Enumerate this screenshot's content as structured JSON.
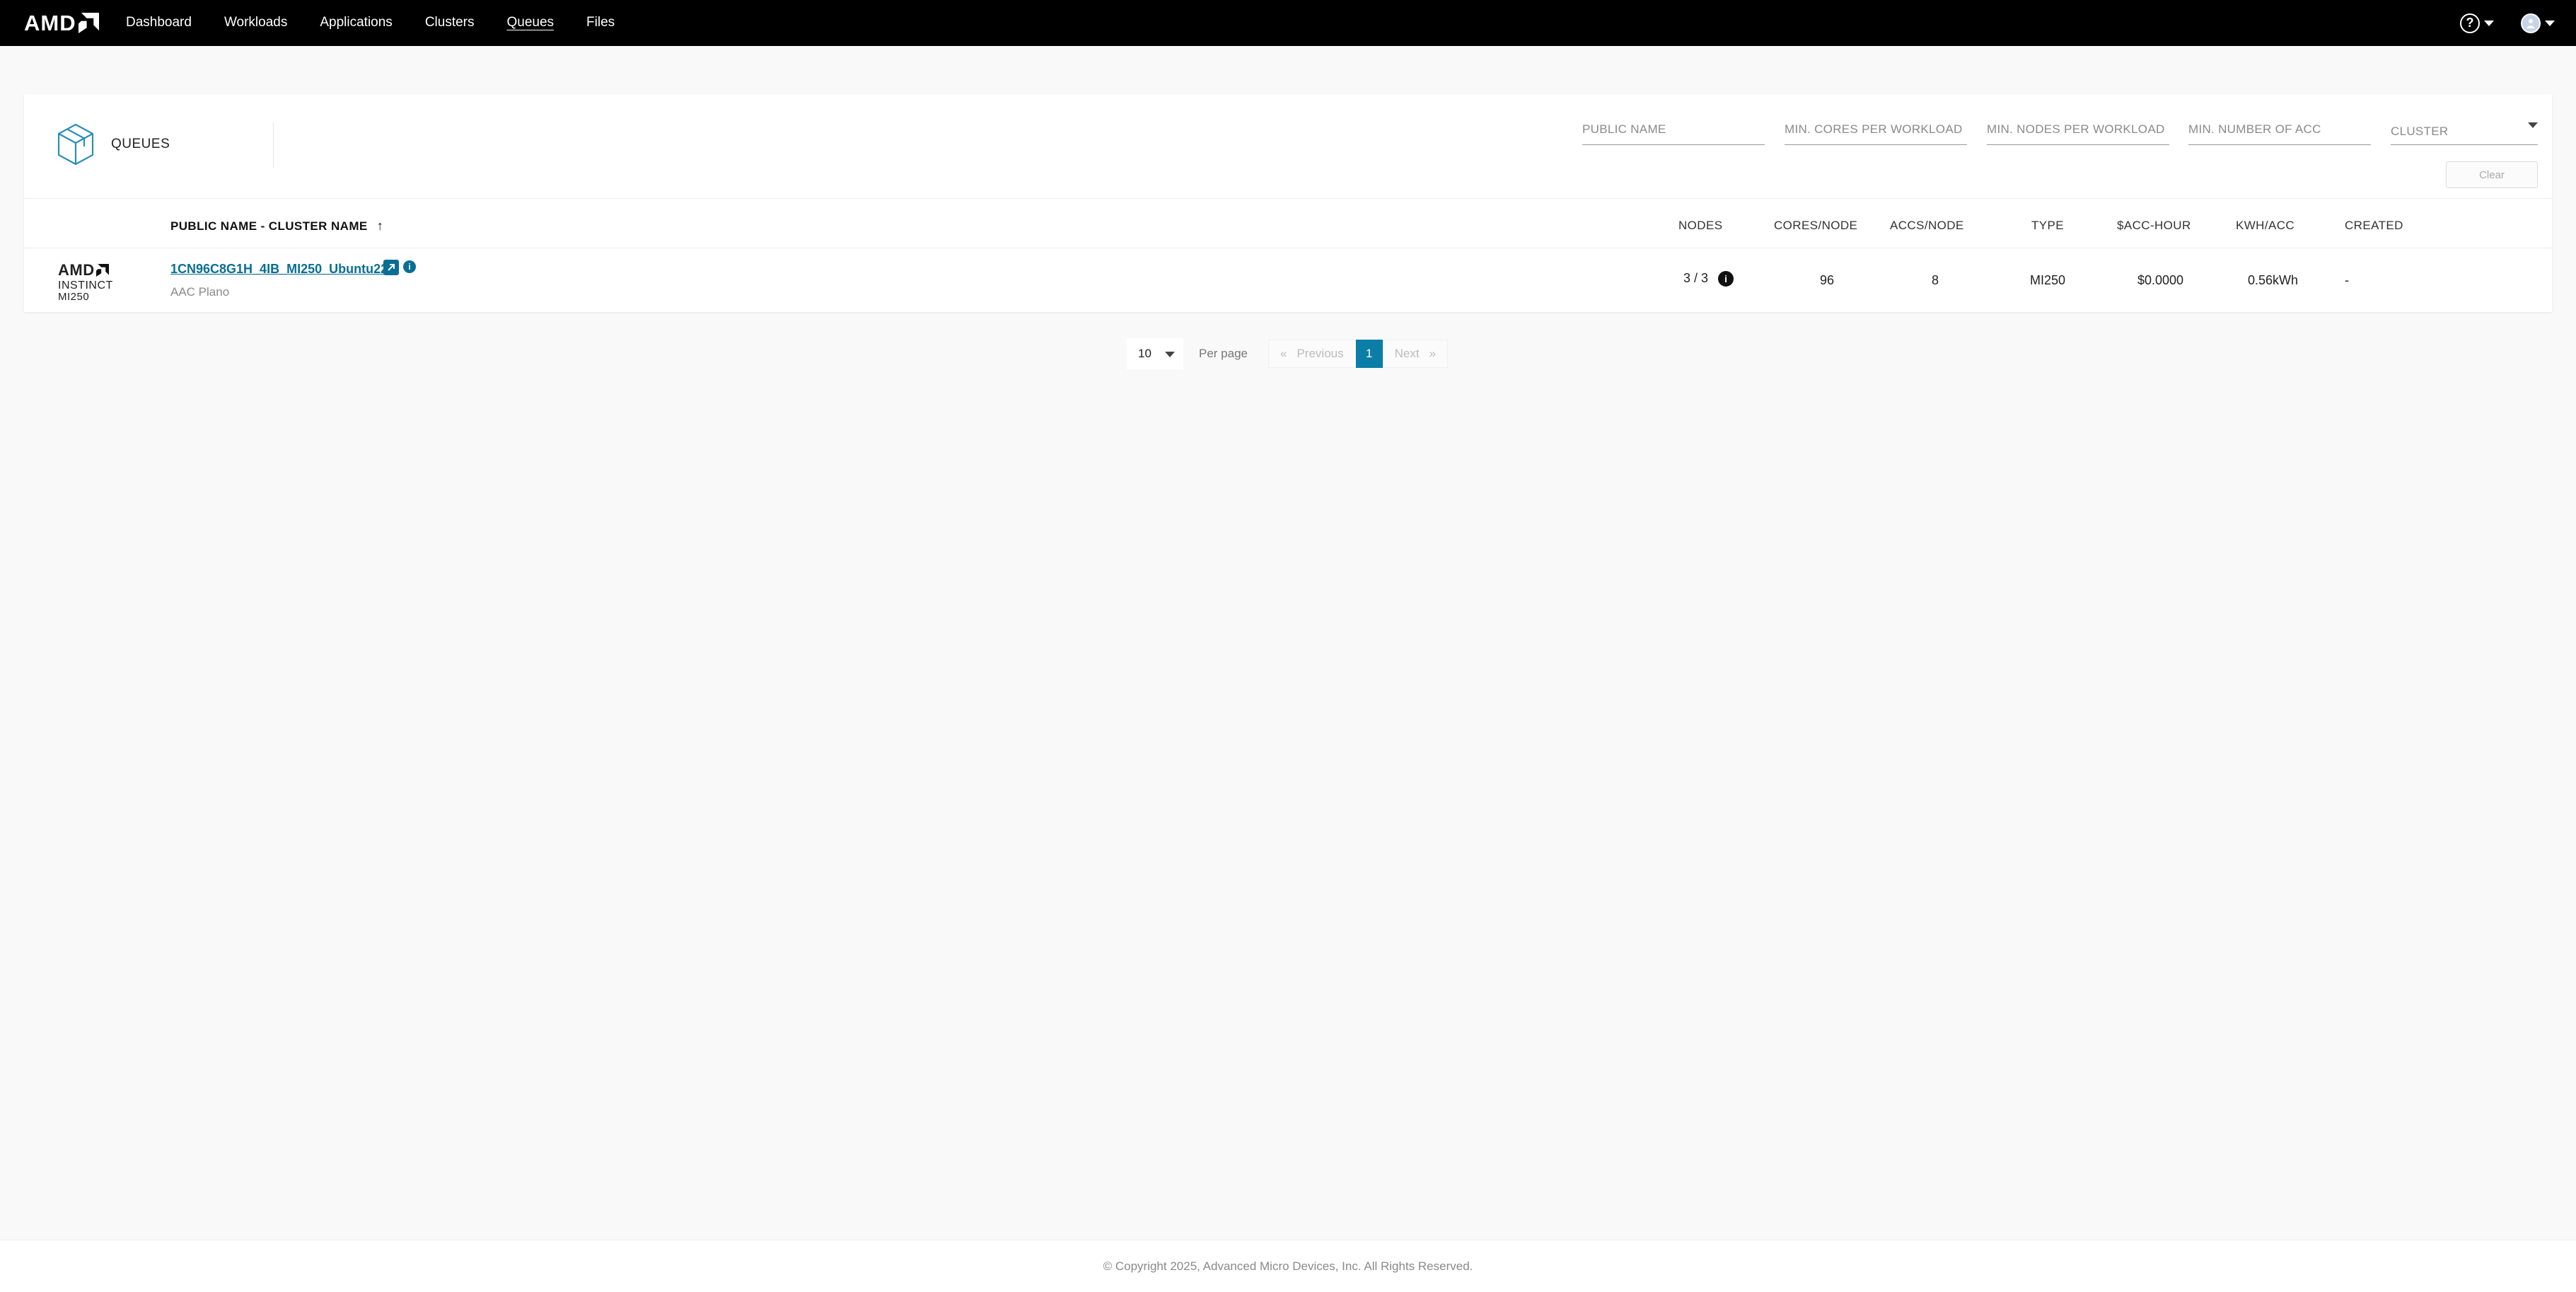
{
  "brand": {
    "logo_text": "AMD"
  },
  "nav": {
    "items": [
      {
        "label": "Dashboard"
      },
      {
        "label": "Workloads"
      },
      {
        "label": "Applications"
      },
      {
        "label": "Clusters"
      },
      {
        "label": "Queues",
        "active": true
      },
      {
        "label": "Files"
      }
    ]
  },
  "header_icons": {
    "help": "help-circle-icon",
    "user": "avatar"
  },
  "card": {
    "title": "QUEUES",
    "filters": {
      "public_name_placeholder": "PUBLIC NAME",
      "min_cores_placeholder": "MIN. CORES PER WORKLOAD",
      "min_nodes_placeholder": "MIN. NODES PER WORKLOAD",
      "min_acc_placeholder": "MIN. NUMBER OF ACC",
      "cluster_placeholder": "CLUSTER"
    },
    "clear_label": "Clear"
  },
  "table": {
    "columns": {
      "name": "PUBLIC NAME - CLUSTER NAME",
      "nodes": "NODES",
      "cores": "CORES/NODE",
      "accs": "ACCS/NODE",
      "type": "TYPE",
      "acc_hour": "$ACC-HOUR",
      "kwh": "KWH/ACC",
      "created": "CREATED"
    },
    "sort_indicator": "↑",
    "rows": [
      {
        "logo_lines": [
          "AMD",
          "INSTINCT",
          "MI250"
        ],
        "name": "1CN96C8G1H_4IB_MI250_Ubuntu22",
        "cluster": "AAC Plano",
        "nodes": "3 / 3",
        "cores": "96",
        "accs": "8",
        "type": "MI250",
        "acc_hour": "$0.0000",
        "kwh": "0.56kWh",
        "created": "-"
      }
    ]
  },
  "pagination": {
    "per_page_value": "10",
    "per_page_label": "Per page",
    "previous_label": "Previous",
    "next_label": "Next",
    "current_page": "1",
    "prev_glyph": "«",
    "next_glyph": "»"
  },
  "footer": {
    "copyright": "© Copyright 2025, Advanced Micro Devices, Inc. All Rights Reserved."
  },
  "colors": {
    "accent": "#0a7ea6",
    "link": "#0a6e94",
    "topbar": "#000000"
  }
}
